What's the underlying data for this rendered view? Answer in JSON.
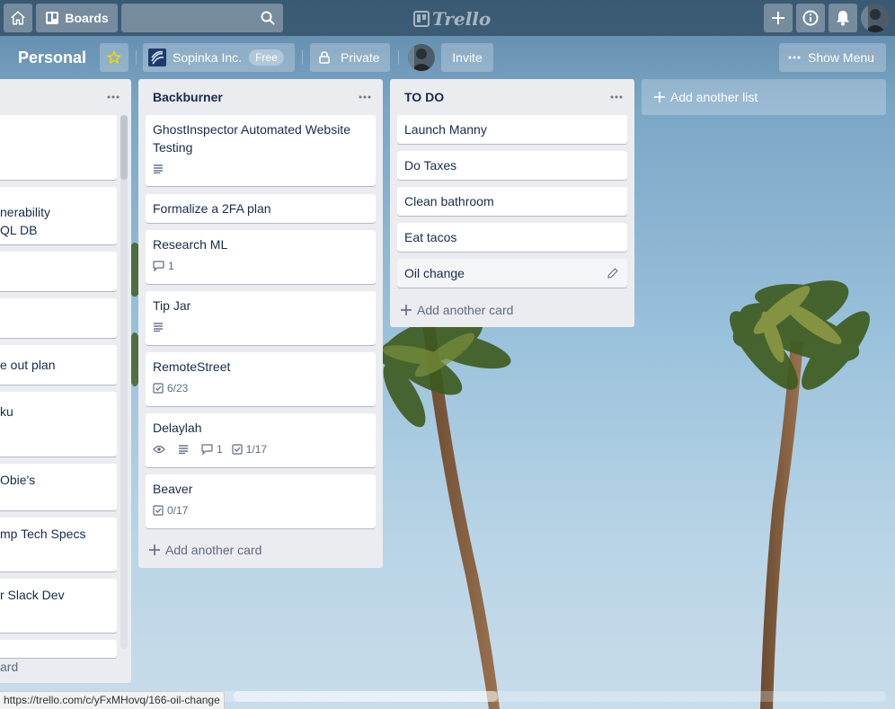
{
  "topbar": {
    "home_icon": "home-icon",
    "boards_label": "Boards",
    "search_placeholder": "",
    "logo_text": "Trello",
    "create_icon": "plus-icon",
    "info_icon": "info-icon",
    "notifications_icon": "bell-icon"
  },
  "board": {
    "title": "Personal",
    "team_name": "Sopinka Inc.",
    "team_plan": "Free",
    "visibility": "Private",
    "invite_label": "Invite",
    "show_menu_label": "Show Menu",
    "star_color": "#f2d600"
  },
  "left_list": {
    "cards": [
      {
        "text": ""
      },
      {
        "text": "nerability\nQL DB"
      },
      {
        "text": ""
      },
      {
        "text": ""
      },
      {
        "text": "e out plan"
      },
      {
        "text": "ku"
      },
      {
        "text": "Obie's"
      },
      {
        "text": "mp Tech Specs"
      },
      {
        "text": "r Slack Dev"
      },
      {
        "text": ""
      }
    ],
    "add_card_label": "ard"
  },
  "backburner": {
    "title": "Backburner",
    "cards": [
      {
        "title": "GhostInspector Automated Website Testing",
        "description": true
      },
      {
        "title": "Formalize a 2FA plan"
      },
      {
        "title": "Research ML",
        "comments": "1"
      },
      {
        "title": "Tip Jar",
        "description": true
      },
      {
        "title": "RemoteStreet",
        "checklist": "6/23"
      },
      {
        "title": "Delaylah",
        "watching": true,
        "description": true,
        "comments": "1",
        "checklist": "1/17"
      },
      {
        "title": "Beaver",
        "checklist": "0/17"
      }
    ],
    "add_card_label": "Add another card"
  },
  "todo": {
    "title": "TO DO",
    "cards": [
      {
        "title": "Launch Manny"
      },
      {
        "title": "Do Taxes"
      },
      {
        "title": "Clean bathroom"
      },
      {
        "title": "Eat tacos"
      },
      {
        "title": "Oil change"
      }
    ],
    "add_card_label": "Add another card"
  },
  "add_list_label": "Add another list",
  "status_url": "https://trello.com/c/yFxMHovq/166-oil-change"
}
